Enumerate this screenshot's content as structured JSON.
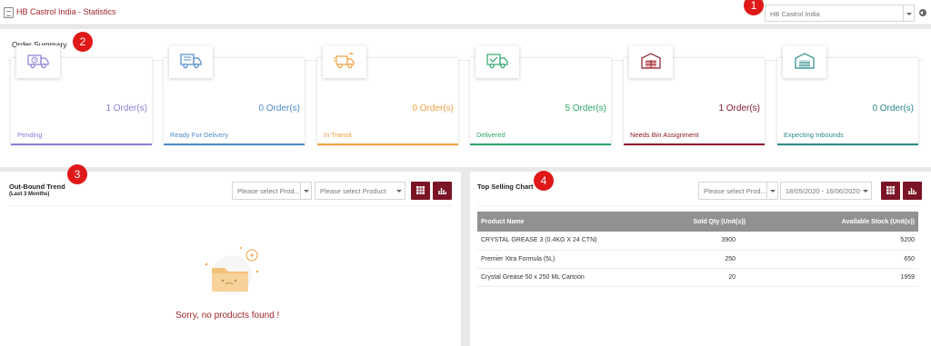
{
  "header": {
    "title": "HB Castrol India - Statistics",
    "company_select": "HB Castrol India"
  },
  "markers": [
    "1",
    "2",
    "3",
    "4"
  ],
  "order_summary": {
    "title": "Order Summary",
    "cards": [
      {
        "count": "1 Order(s)",
        "label": "Pending",
        "color": "#8a7fd6",
        "icon": "clock-truck-icon"
      },
      {
        "count": "0 Order(s)",
        "label": "Ready For Delivery",
        "color": "#4d8cc8",
        "icon": "loaded-truck-icon"
      },
      {
        "count": "0 Order(s)",
        "label": "In Transit",
        "color": "#f0a040",
        "icon": "moving-truck-icon"
      },
      {
        "count": "5 Order(s)",
        "label": "Delivered",
        "color": "#2ea66a",
        "icon": "check-truck-icon"
      },
      {
        "count": "1 Order(s)",
        "label": "Needs Bin Assignment",
        "color": "#8b1a2b",
        "icon": "warehouse-icon"
      },
      {
        "count": "0 Order(s)",
        "label": "Expecting Inbounds",
        "color": "#2a8a8a",
        "icon": "inbound-warehouse-icon"
      }
    ]
  },
  "outbound": {
    "title": "Out-Bound Trend",
    "subtitle": "(Last 3 Months)",
    "product_select_1": "Please select Prod...",
    "product_select_2": "Please select Product",
    "empty_message": "Sorry, no products found !"
  },
  "top_selling": {
    "title": "Top Selling Chart",
    "product_select": "Please select Prod...",
    "date_range": "18/05/2020 - 16/06/2020",
    "columns": [
      "Product Name",
      "Sold Qty (Unit(s))",
      "Available Stock (Unit(s))"
    ],
    "rows": [
      [
        "CRYSTAL GREASE 3 (0.4KG X 24 CTN)",
        "3900",
        "5200"
      ],
      [
        "Premier Xtra Formula (5L)",
        "250",
        "650"
      ],
      [
        "Crystal Grease 50 x 250 ML Cartoon",
        "20",
        "1959"
      ]
    ]
  }
}
